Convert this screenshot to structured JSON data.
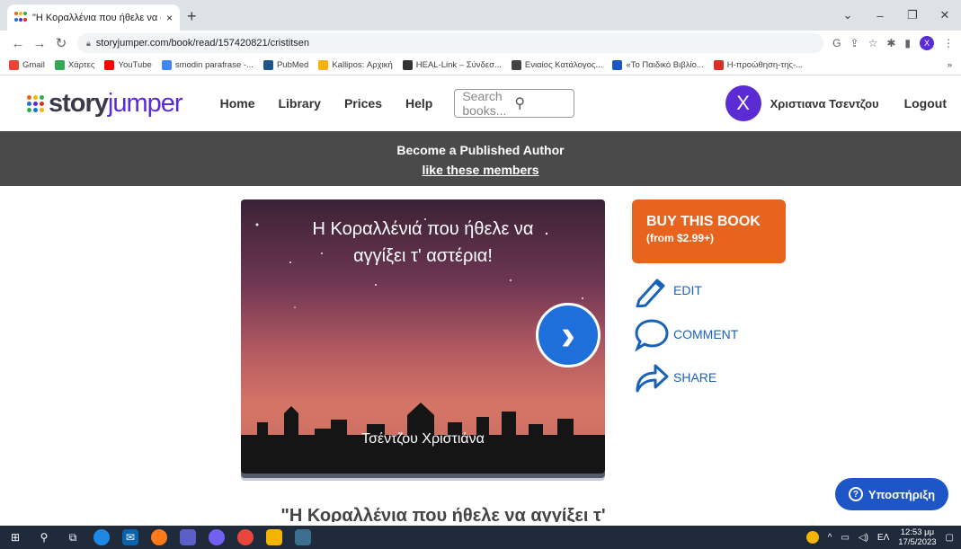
{
  "browser": {
    "tab_title": "\"Η Κοραλλένια που ήθελε να αγγ",
    "tab_close": "×",
    "new_tab": "+",
    "url": "storyjumper.com/book/read/157420821/cristitsen",
    "profile_initial": "X",
    "bookmarks": [
      {
        "label": "Gmail",
        "color": "#ea4335"
      },
      {
        "label": "Χάρτες",
        "color": "#34a853"
      },
      {
        "label": "YouTube",
        "color": "#ff0000"
      },
      {
        "label": "smodin parafrase -...",
        "color": "#4285f4"
      },
      {
        "label": "PubMed",
        "color": "#20558a"
      },
      {
        "label": "Kallipos: Αρχική",
        "color": "#f4b400"
      },
      {
        "label": "HEAL-Link – Σύνδεσ...",
        "color": "#333333"
      },
      {
        "label": "Ενιαίος Κατάλογος...",
        "color": "#444444"
      },
      {
        "label": "«Το Παιδικό Βιβλίο...",
        "color": "#1a56c8"
      },
      {
        "label": "Η-προώθηση-της-...",
        "color": "#d93025"
      }
    ],
    "bookmarks_more": "»"
  },
  "site": {
    "logo_story": "story",
    "logo_jumper": "jumper",
    "nav": [
      "Home",
      "Library",
      "Prices",
      "Help"
    ],
    "search_placeholder": "Search books...",
    "avatar_initial": "X",
    "user_name": "Χριστιανα Τσεντζου",
    "logout": "Logout",
    "banner_line1": "Become a Published Author",
    "banner_line2": "like these members"
  },
  "book": {
    "title_line1": "Η Κοραλλένιά που ήθελε να",
    "title_line2": "αγγίξει τ' αστέρια!",
    "author": "Τσέντζου Χριστιάνα",
    "caption": "\"Η Κοραλλένια που ήθελε να αγγίξει τ'",
    "next_glyph": "›"
  },
  "actions": {
    "buy_line1": "BUY THIS BOOK",
    "buy_line2": "(from $2.99+)",
    "edit": "EDIT",
    "comment": "COMMENT",
    "share": "SHARE"
  },
  "support": {
    "label": "Υποστήριξη",
    "glyph": "?"
  },
  "taskbar": {
    "lang": "ΕΛ",
    "time": "12:53 μμ",
    "date": "17/5/2023"
  }
}
